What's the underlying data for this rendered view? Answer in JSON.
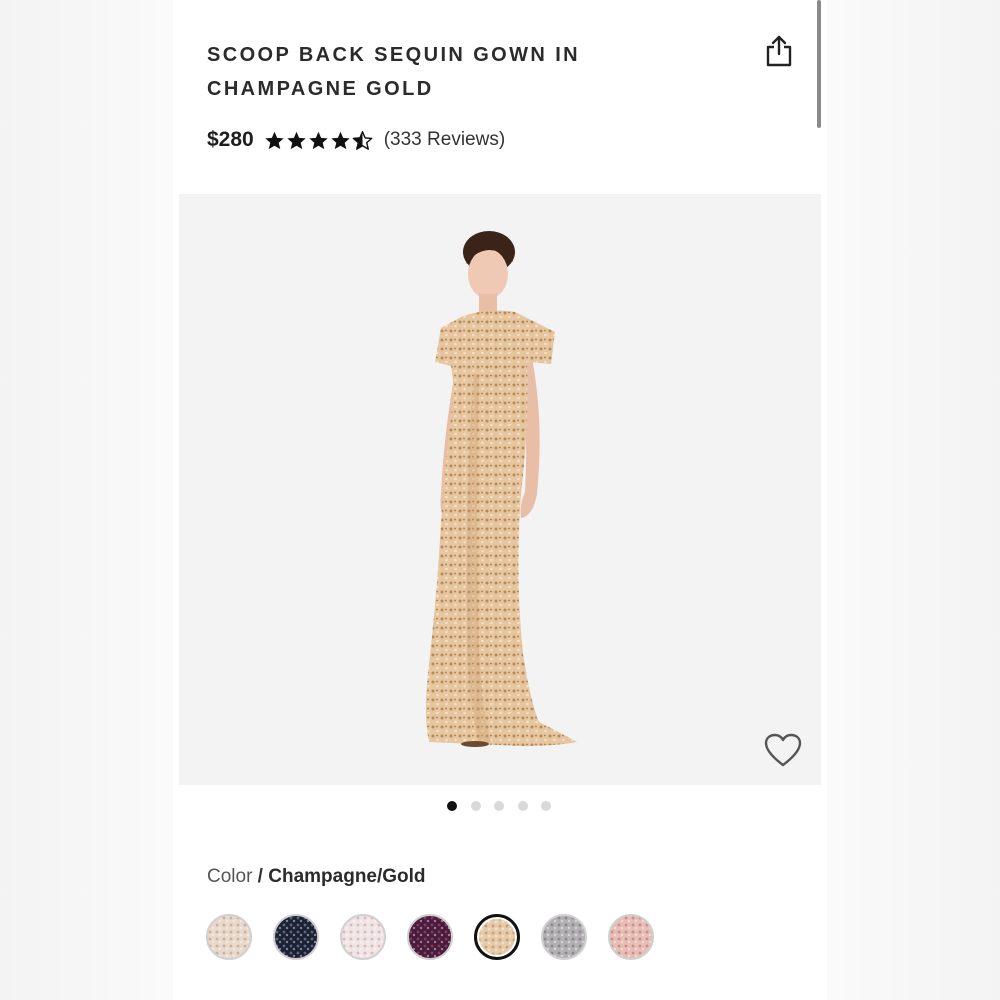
{
  "product": {
    "title_line1": "SCOOP BACK SEQUIN GOWN IN",
    "title_line2": "CHAMPAGNE GOLD",
    "price": "$280",
    "rating": 4.5,
    "rating_max": 5,
    "reviews": "(333 Reviews)"
  },
  "gallery": {
    "image_count": 5,
    "active_index": 0
  },
  "color": {
    "label": "Color",
    "separator": " / ",
    "selected": "Champagne/Gold",
    "swatches": [
      {
        "name": "swatch-blush-silver",
        "base": "#e8d9cc",
        "speck": "#c9b29b",
        "selected": false
      },
      {
        "name": "swatch-navy",
        "base": "#1c2233",
        "speck": "#5a6580",
        "selected": false
      },
      {
        "name": "swatch-light-pink",
        "base": "#f1e4e4",
        "speck": "#d2bcbf",
        "selected": false
      },
      {
        "name": "swatch-plum",
        "base": "#4b1b3a",
        "speck": "#7e3d69",
        "selected": false
      },
      {
        "name": "swatch-champagne-gold",
        "base": "#e6cbaa",
        "speck": "#c79e72",
        "selected": true
      },
      {
        "name": "swatch-silver",
        "base": "#b3b0b3",
        "speck": "#8b888c",
        "selected": false
      },
      {
        "name": "swatch-rose-gold",
        "base": "#e7bdb5",
        "speck": "#c78f88",
        "selected": false
      }
    ]
  },
  "icons": {
    "share": "share-icon",
    "wishlist": "heart-icon",
    "star": "star-icon"
  }
}
